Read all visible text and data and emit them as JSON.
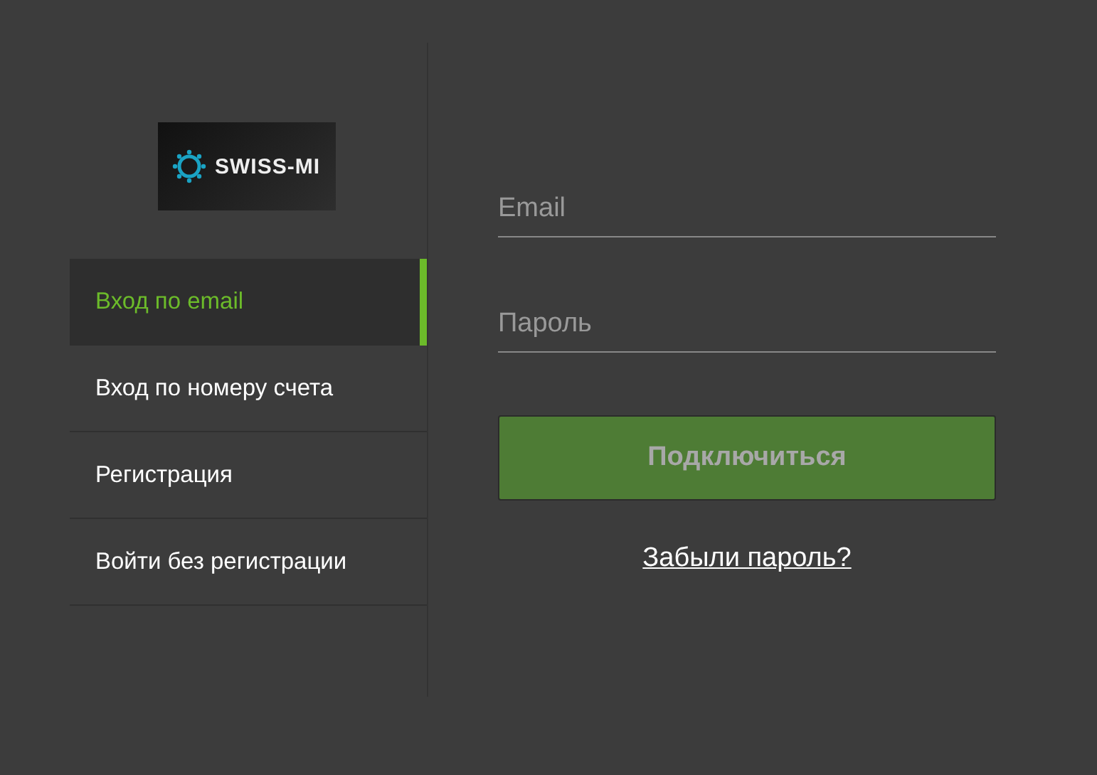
{
  "logo": {
    "text": "SWISS-MI"
  },
  "menu": [
    {
      "label": "Вход по email",
      "selected": true
    },
    {
      "label": "Вход по номеру счета",
      "selected": false
    },
    {
      "label": "Регистрация",
      "selected": false
    },
    {
      "label": "Войти без регистрации",
      "selected": false
    }
  ],
  "form": {
    "fields": [
      {
        "placeholder": "Email"
      },
      {
        "placeholder": "Пароль"
      }
    ],
    "submit": "Подключиться",
    "forgot_link": "Забыли пароль?"
  }
}
